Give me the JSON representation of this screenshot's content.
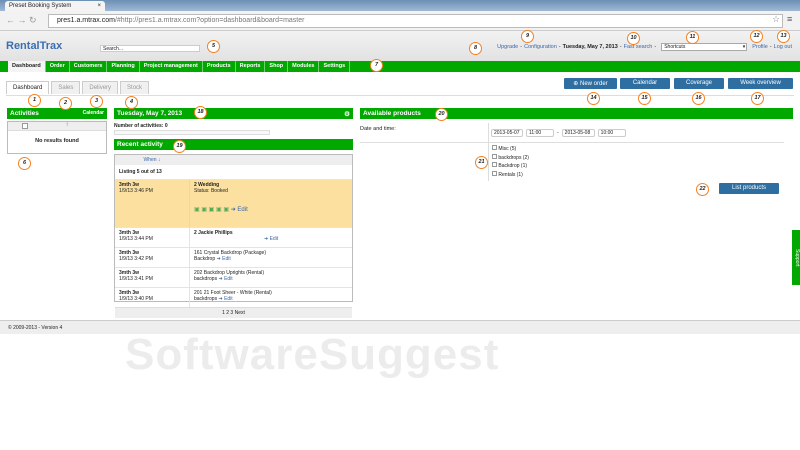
{
  "browser": {
    "tab_title": "Preset Booking System",
    "url_host": "pres1.a.mtrax.com",
    "url_rest": "/#http://pres1.a.mtrax.com?option=dashboard&board=master"
  },
  "header": {
    "logo": "RentalTrax",
    "search_placeholder": "Search...",
    "upgrade": "Upgrade",
    "configuration": "Configuration",
    "date": "Tuesday, May 7, 2013",
    "fast_search": "Fast search",
    "shortcuts": "Shortcuts",
    "profile": "Profile",
    "logout": "Log out",
    "sep": "-"
  },
  "nav": [
    "Dashboard",
    "Order",
    "Customers",
    "Planning",
    "Project management",
    "Products",
    "Reports",
    "Shop",
    "Modules",
    "Settings"
  ],
  "subtabs": [
    "Dashboard",
    "Sales",
    "Delivery",
    "Stock"
  ],
  "buttons": {
    "new_order": "New order",
    "calendar": "Calendar",
    "coverage": "Coverage",
    "week_overview": "Week overview",
    "list_products": "List products"
  },
  "activities": {
    "title": "Activities",
    "calendar": "Calendar",
    "empty": "No results found"
  },
  "day": {
    "title": "Tuesday, May 7, 2013",
    "count": "Number of activities: 0"
  },
  "recent": {
    "title": "Recent activity",
    "col_when": "When",
    "listing": "Listing 5 out of 13",
    "pager": "1 2 3 Next",
    "edit": "Edit",
    "rows": [
      {
        "when": "3mth 3w",
        "time": "1/9/13 3:46 PM",
        "title": "2 Wedding",
        "sub": "Status: Booked"
      },
      {
        "when": "3mth 3w",
        "time": "1/9/13 3:44 PM",
        "title": "2 Jackie Phillips",
        "sub": ""
      },
      {
        "when": "3mth 3w",
        "time": "1/9/13 3:42 PM",
        "title": "161 Crystal Backdrop (Package)",
        "sub": "Backdrop"
      },
      {
        "when": "3mth 3w",
        "time": "1/9/13 3:41 PM",
        "title": "202 Backdrop Uprights (Rental)",
        "sub": "backdrops"
      },
      {
        "when": "3mth 3w",
        "time": "1/9/13 3:40 PM",
        "title": "201 21 Foot Sheer - White (Rental)",
        "sub": "backdrops"
      }
    ]
  },
  "available": {
    "title": "Available products",
    "date_label": "Date and time:",
    "from_date": "2013-05-07",
    "from_time": "11:00",
    "to_date": "2013-05-08",
    "to_time": "10:00",
    "dash": "-",
    "categories": [
      "Misc (5)",
      "backdrops (2)",
      "Backdrop (1)",
      "Rentals (1)"
    ]
  },
  "footer": "© 2009-2013 - Version 4",
  "support": "Support",
  "watermark": "SoftwareSuggest",
  "callouts": [
    "1",
    "2",
    "3",
    "4",
    "5",
    "6",
    "7",
    "8",
    "9",
    "10",
    "11",
    "12",
    "13",
    "14",
    "15",
    "16",
    "17",
    "18",
    "19",
    "20",
    "21",
    "22"
  ]
}
